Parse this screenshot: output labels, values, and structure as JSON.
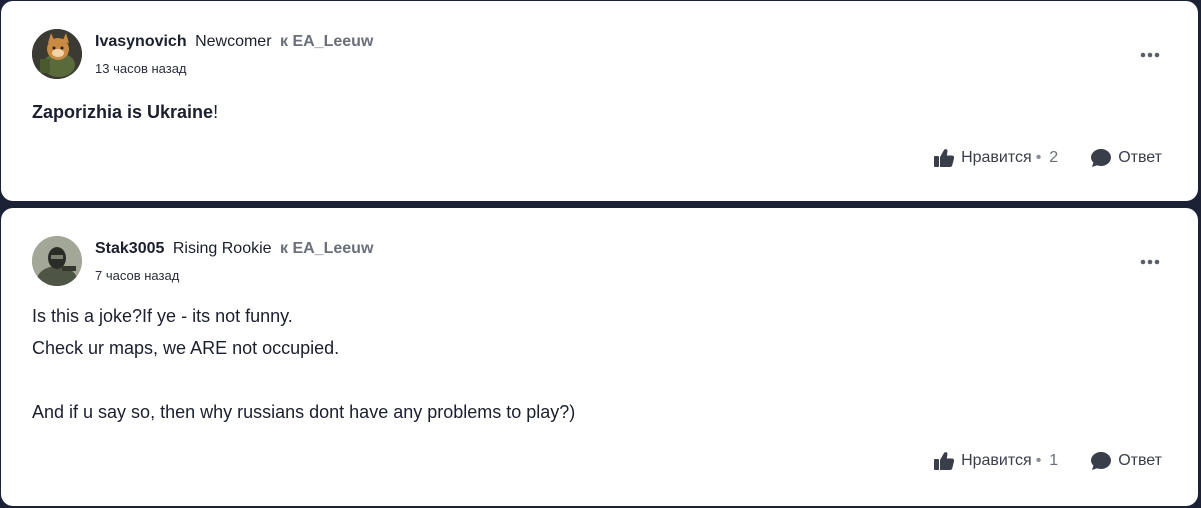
{
  "posts": [
    {
      "username": "Ivasynovich",
      "rank": "Newcomer",
      "reply_to": "к EA_Leeuw",
      "timestamp": "13 часов назад",
      "body": {
        "bold": "Zaporizhia is Ukraine",
        "rest": "!"
      },
      "like_label": "Нравится",
      "like_separator": "•",
      "like_count": "2",
      "reply_label": "Ответ"
    },
    {
      "username": "Stak3005",
      "rank": "Rising Rookie",
      "reply_to": "к EA_Leeuw",
      "timestamp": "7 часов назад",
      "body_lines": [
        "Is this a joke?If ye - its not funny.",
        "Check ur maps, we ARE not occupied.",
        "",
        "And if u say so, then why russians dont have any problems to play?)"
      ],
      "like_label": "Нравится",
      "like_separator": "•",
      "like_count": "1",
      "reply_label": "Ответ"
    }
  ],
  "icons": {
    "more": "more-horizontal-icon",
    "like": "thumbs-up-icon",
    "reply": "speech-bubble-icon"
  },
  "colors": {
    "background": "#1b2236",
    "card": "#ffffff",
    "text": "#1b1f2e",
    "muted": "#6b6f7b"
  }
}
